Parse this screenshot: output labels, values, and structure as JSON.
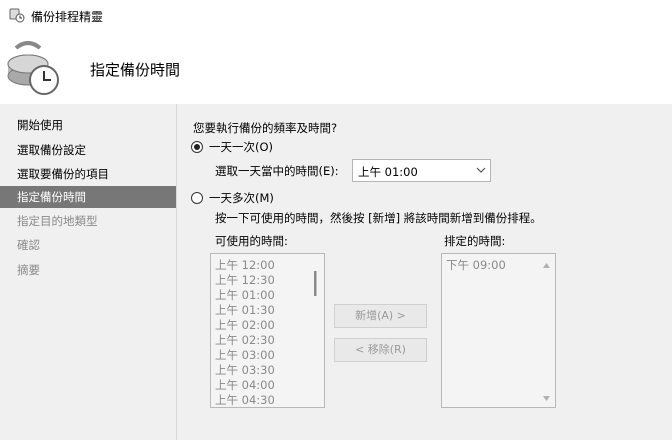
{
  "window": {
    "title": "備份排程精靈"
  },
  "header": {
    "heading": "指定備份時間"
  },
  "sidebar": {
    "items": [
      {
        "label": "開始使用",
        "state": "normal"
      },
      {
        "label": "選取備份設定",
        "state": "normal"
      },
      {
        "label": "選取要備份的項目",
        "state": "normal"
      },
      {
        "label": "指定備份時間",
        "state": "active"
      },
      {
        "label": "指定目的地類型",
        "state": "disabled"
      },
      {
        "label": "確認",
        "state": "disabled"
      },
      {
        "label": "摘要",
        "state": "disabled"
      }
    ]
  },
  "main": {
    "question": "您要執行備份的頻率及時間?",
    "once_daily": {
      "label": "一天一次(O)",
      "selected": true
    },
    "time_of_day": {
      "label": "選取一天當中的時間(E):",
      "value": "上午 01:00"
    },
    "multiple": {
      "label": "一天多次(M)",
      "selected": false
    },
    "instruction": "按一下可使用的時間，然後按 [新增] 將該時間新增到備份排程。",
    "available": {
      "label": "可使用的時間:",
      "items": [
        "上午 12:00",
        "上午 12:30",
        "上午 01:00",
        "上午 01:30",
        "上午 02:00",
        "上午 02:30",
        "上午 03:00",
        "上午 03:30",
        "上午 04:00",
        "上午 04:30"
      ]
    },
    "scheduled": {
      "label": "排定的時間:",
      "items": [
        "下午 09:00"
      ]
    },
    "add_button": "新增(A) >",
    "remove_button": "< 移除(R)"
  },
  "colors": {
    "active_sidebar": "#777777",
    "disabled_text": "#8a8a8a"
  }
}
